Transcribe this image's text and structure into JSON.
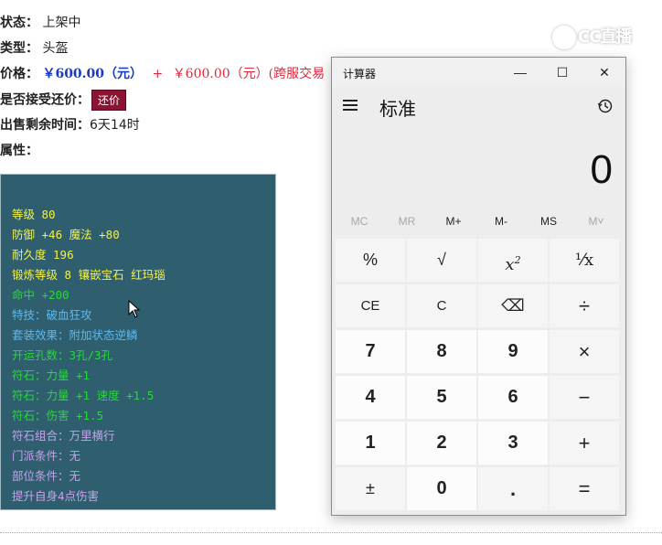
{
  "listing": {
    "status_label": "状态：",
    "status_value": "上架中",
    "type_label": "类型：",
    "type_value": "头盔",
    "price_label": "价格：",
    "price_a": "￥600.00（元）",
    "price_plus": "+",
    "price_b": "￥600.00（元）(跨服交易",
    "bargain_label": "是否接受还价：",
    "bargain_button": "还价",
    "remaining_label": "出售剩余时间：",
    "remaining_value": "6天14时",
    "attr_label": "属性："
  },
  "attributes": [
    {
      "text": "等级 80",
      "color": "#f2f24a"
    },
    {
      "text": "防御 +46 魔法 +80",
      "color": "#f2f24a"
    },
    {
      "text": "耐久度 196",
      "color": "#f2f24a"
    },
    {
      "text": "锻炼等级 8 镶嵌宝石 红玛瑙",
      "color": "#f2f24a"
    },
    {
      "text": "命中 +200",
      "color": "#27d83a"
    },
    {
      "text": "特技：破血狂攻",
      "color": "#5fb8ee"
    },
    {
      "text": "套装效果：附加状态逆鳞",
      "color": "#5fb8ee"
    },
    {
      "text": "开运孔数：3孔/3孔",
      "color": "#27d83a"
    },
    {
      "text": "符石：力量 +1",
      "color": "#27d83a"
    },
    {
      "text": "符石：力量 +1 速度 +1.5",
      "color": "#27d83a"
    },
    {
      "text": "符石：伤害 +1.5",
      "color": "#27d83a"
    },
    {
      "text": "符石组合：万里横行",
      "color": "#c9a0ee"
    },
    {
      "text": "门派条件：无",
      "color": "#c9a0ee"
    },
    {
      "text": "部位条件：无",
      "color": "#c9a0ee"
    },
    {
      "text": "提升自身4点伤害",
      "color": "#c9a0ee"
    }
  ],
  "watermark": "CC直播",
  "calculator": {
    "title": "计算器",
    "minimize": "—",
    "maximize": "☐",
    "close": "✕",
    "mode": "标准",
    "display": "0",
    "memory": [
      {
        "label": "MC",
        "enabled": false
      },
      {
        "label": "MR",
        "enabled": false
      },
      {
        "label": "M+",
        "enabled": true
      },
      {
        "label": "M-",
        "enabled": true
      },
      {
        "label": "MS",
        "enabled": true
      },
      {
        "label": "M˅",
        "enabled": false
      }
    ],
    "keys": {
      "percent": "%",
      "sqrt": "√",
      "square": "x",
      "square_sup": "2",
      "reciprocal": "¹⁄x",
      "ce": "CE",
      "c": "C",
      "backspace": "⌫",
      "divide": "÷",
      "seven": "7",
      "eight": "8",
      "nine": "9",
      "multiply": "×",
      "four": "4",
      "five": "5",
      "six": "6",
      "minus": "−",
      "one": "1",
      "two": "2",
      "three": "3",
      "plus": "+",
      "negate": "±",
      "zero": "0",
      "decimal": ".",
      "equals": "="
    }
  }
}
